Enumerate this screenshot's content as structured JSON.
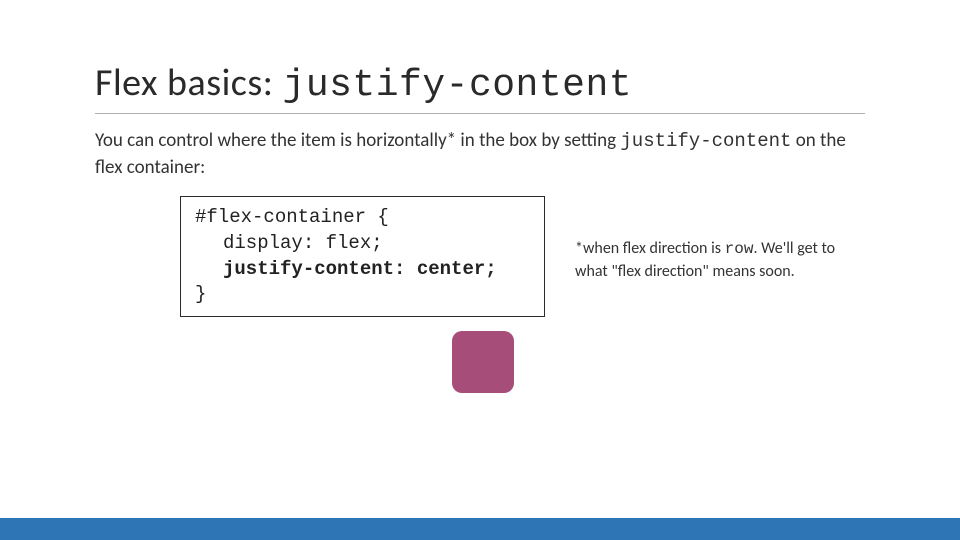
{
  "title_prefix": "Flex basics: ",
  "title_code": "justify-content",
  "body_part1": "You can control where the item is horizontally* in the box by setting ",
  "body_code": "justify-content",
  "body_part2": " on the flex container:",
  "code": {
    "line1": "#flex-container {",
    "line2": "display: flex;",
    "line3": "justify-content: center;",
    "line4": "}"
  },
  "note_part1": "*when flex direction is ",
  "note_code": "row",
  "note_part2": ". We'll get to what \"flex direction\" means soon.",
  "colors": {
    "accent_bar": "#2e75b6",
    "demo_box": "#a64d79"
  }
}
